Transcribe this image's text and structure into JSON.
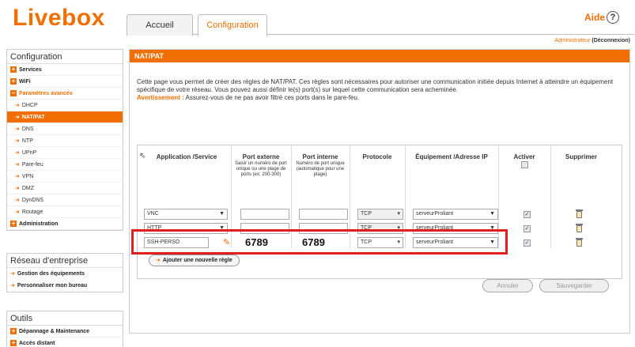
{
  "header": {
    "logo": "Livebox",
    "tabs": [
      {
        "label": "Accueil"
      },
      {
        "label": "Configuration"
      }
    ],
    "help_label": "Aide",
    "help_glyph": "?",
    "user_role": "Administrateur",
    "logout_label": "(Déconnexion)"
  },
  "sidebar": {
    "config_title": "Configuration",
    "items": [
      {
        "label": "Services",
        "type": "group"
      },
      {
        "label": "WiFi",
        "type": "group"
      },
      {
        "label": "Paramètres avancés",
        "type": "group-open"
      },
      {
        "label": "DHCP",
        "type": "sub"
      },
      {
        "label": "NAT/PAT",
        "type": "sub",
        "active": true
      },
      {
        "label": "DNS",
        "type": "sub"
      },
      {
        "label": "NTP",
        "type": "sub"
      },
      {
        "label": "UPnP",
        "type": "sub"
      },
      {
        "label": "Pare-feu",
        "type": "sub"
      },
      {
        "label": "VPN",
        "type": "sub"
      },
      {
        "label": "DMZ",
        "type": "sub"
      },
      {
        "label": "DynDNS",
        "type": "sub"
      },
      {
        "label": "Routage",
        "type": "sub"
      },
      {
        "label": "Administration",
        "type": "group"
      }
    ],
    "enterprise_title": "Réseau d'entreprise",
    "enterprise_items": [
      {
        "label": "Gestion des équipements"
      },
      {
        "label": "Personnaliser mon bureau"
      }
    ],
    "tools_title": "Outils",
    "tools_items": [
      {
        "label": "Dépannage & Maintenance"
      },
      {
        "label": "Accès distant"
      }
    ]
  },
  "main": {
    "section_title": "NAT/PAT",
    "intro": "Cette page vous permet de créer des règles de NAT/PAT. Ces règles sont nécessaires pour autoriser une communication initiée depuis Internet à atteindre un équipement spécifique de votre réseau. Vous pouvez aussi définir le(s) port(s) sur lequel cette communication sera acheminée.",
    "warning_label": "Avertissement :",
    "warning_text": " Assurez-vous de ne pas avoir filtré ces ports dans le pare-feu.",
    "columns": {
      "application": "Application /Service",
      "port_ext": "Port externe",
      "port_ext_note": "Saisir un numéro de port unique ou une plage de ports (ex: 200-300)",
      "port_int": "Port interne",
      "port_int_note": "Numéro de port unique (automatique pour une plage)",
      "protocol": "Protocole",
      "device": "Équipement /Adresse IP",
      "enable": "Activer",
      "delete": "Supprimer"
    },
    "rows": [
      {
        "application": "VNC",
        "port_ext": "",
        "port_int": "",
        "protocol": "TCP",
        "device": "serveurProliant",
        "enabled": true
      },
      {
        "application": "HTTP",
        "port_ext": "",
        "port_int": "",
        "protocol": "TCP",
        "device": "serveurProliant",
        "enabled": true
      },
      {
        "application": "SSH-PERSO",
        "port_ext": "6789",
        "port_int": "6789",
        "protocol": "TCP",
        "device": "serveurProliant",
        "enabled": true
      }
    ],
    "add_rule_label": "Ajouter une nouvelle règle",
    "cancel_label": "Annuler",
    "save_label": "Sauvegarder"
  },
  "colors": {
    "brand": "#f16e00",
    "highlight": "#e01e1e"
  }
}
